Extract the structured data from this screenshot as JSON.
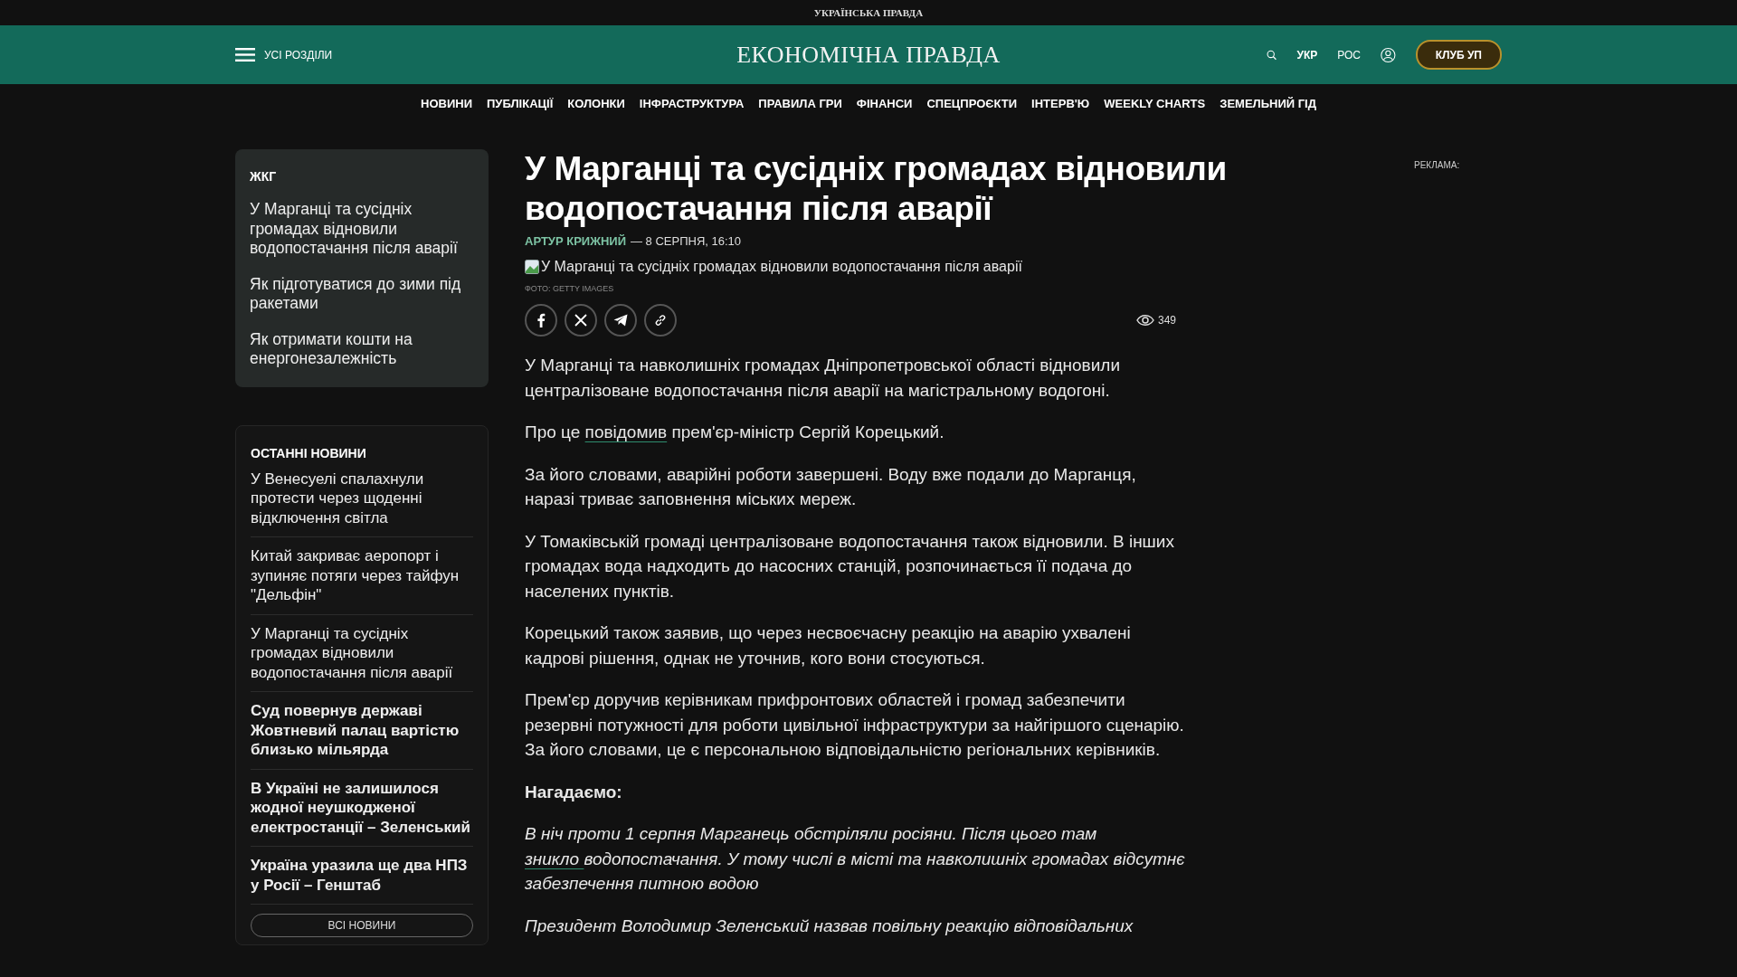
{
  "top_bar": {
    "title": "УКРАЇНСЬКА ПРАВДА"
  },
  "header": {
    "menu_label": "УСІ РОЗДІЛИ",
    "logo": "ЕКОНОМІЧНА ПРАВДА",
    "languages": [
      {
        "label": "УКР",
        "selected": true
      },
      {
        "label": "РОС",
        "selected": false
      }
    ],
    "club_button": "КЛУБ УП"
  },
  "nav": [
    "НОВИНИ",
    "ПУБЛІКАЦІЇ",
    "КОЛОНКИ",
    "ІНФРАСТРУКТУРА",
    "ПРАВИЛА ГРИ",
    "ФІНАНСИ",
    "СПЕЦПРОЄКТИ",
    "ІНТЕРВ'Ю",
    "WEEKLY CHARTS",
    "ЗЕМЕЛЬНИЙ ГІД"
  ],
  "topic_box": {
    "title": "ЖКГ",
    "items": [
      "У Марганці та сусідніх громадах відновили водопостачання після аварії",
      "Як підготуватися до зими під ракетами",
      "Як отримати кошти на енергонезалежність"
    ]
  },
  "latest_news": {
    "title": "ОСТАННІ НОВИНИ",
    "items": [
      {
        "text": "У Венесуелі спалахнули протести через щоденні відключення світла",
        "bold": false
      },
      {
        "text": "Китай закриває аеропорт і зупиняє потяги через тайфун \"Дельфін\"",
        "bold": false
      },
      {
        "text": "У Марганці та сусідніх громадах відновили водопостачання після аварії",
        "bold": false
      },
      {
        "text": "Суд повернув державі Жовтневий палац вартістю близько мільярда",
        "bold": true
      },
      {
        "text": "В Україні не залишилося жодної неушкодженої електростанції – Зеленський",
        "bold": true
      },
      {
        "text": "Україна уразила ще два НПЗ у Росії – Генштаб",
        "bold": true
      }
    ],
    "all_button": "ВСІ НОВИНИ"
  },
  "article": {
    "title": "У Марганці та сусідніх громадах відновили водопостачання після аварії",
    "author": "АРТУР КРИЖНИЙ",
    "date": "— 8 СЕРПНЯ, 16:10",
    "image_alt": "У Марганці та сусідніх громадах відновили водопостачання після аварії",
    "photo_credit": "ФОТО: GETTY IMAGES",
    "views": "349",
    "paragraphs": [
      {
        "kind": "text",
        "parts": [
          {
            "text": "У Марганці та навколишніх громадах Дніпропетровської області відновили централізоване водопостачання після аварії на магістральному водогоні.",
            "link": false
          }
        ]
      },
      {
        "kind": "text",
        "parts": [
          {
            "text": "Про це ",
            "link": false
          },
          {
            "text": "повідомив",
            "link": true
          },
          {
            "text": " прем'єр-міністр Сергій Корецький.",
            "link": false
          }
        ]
      },
      {
        "kind": "text",
        "parts": [
          {
            "text": "За його словами, аварійні роботи завершені. Воду вже подали до Марганця, наразі триває заповнення міських мереж.",
            "link": false
          }
        ]
      },
      {
        "kind": "text",
        "parts": [
          {
            "text": "У Томаківській громаді централізоване водопостачання також відновили. В інших громадах вода надходить до насосних станцій, розпочинається її подача до населених пунктів.",
            "link": false
          }
        ]
      },
      {
        "kind": "text",
        "parts": [
          {
            "text": "Корецький також заявив, що через несвоєчасну реакцію на аварію ухвалені кадрові рішення, однак не уточнив, кого вони стосуються.",
            "link": false
          }
        ]
      },
      {
        "kind": "text",
        "parts": [
          {
            "text": "Прем'єр доручив керівникам прифронтових областей і громад забезпечити резервні потужності для роботи цивільної інфраструктури за найгіршого сценарію. За його словами, це є персональною відповідальністю регіональних керівників.",
            "link": false
          }
        ]
      },
      {
        "kind": "subheading",
        "parts": [
          {
            "text": "Нагадаємо:",
            "link": false
          }
        ]
      },
      {
        "kind": "quote",
        "parts": [
          {
            "text": "В ніч проти 1 серпня Марганець обстріляли росіяни. Після цього там ",
            "link": false
          },
          {
            "text": "зникло ",
            "link": true
          },
          {
            "text": "водопостачання. У тому числі в місті та навколишніх громадах відсутнє забезпечення питною водою",
            "link": false
          }
        ]
      },
      {
        "kind": "quote",
        "parts": [
          {
            "text": "Президент Володимир Зеленський назвав повільну реакцію відповідальних",
            "link": false
          }
        ]
      }
    ]
  },
  "ad": {
    "label": "РЕКЛАМА:"
  }
}
